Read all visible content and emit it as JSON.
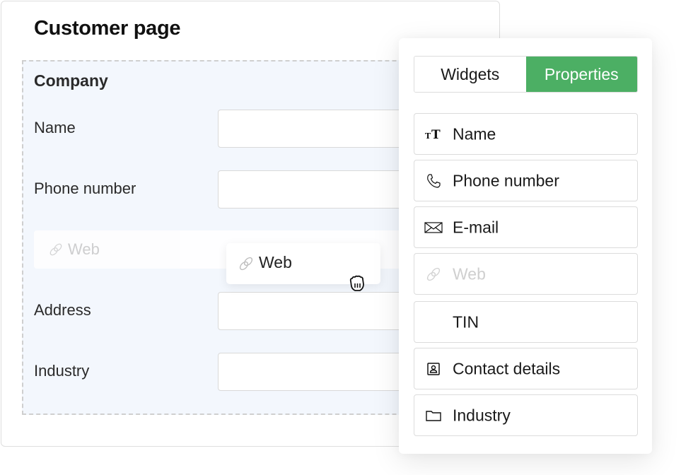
{
  "page": {
    "title": "Customer page"
  },
  "form": {
    "section_title": "Company",
    "fields": [
      {
        "label": "Name",
        "value": ""
      },
      {
        "label": "Phone number",
        "value": ""
      },
      {
        "label": "Address",
        "value": ""
      },
      {
        "label": "Industry",
        "value": ""
      }
    ],
    "drop_placeholder": {
      "label": "Web",
      "icon": "link-icon"
    },
    "dragged_item": {
      "label": "Web",
      "icon": "link-icon"
    },
    "cursor": "grab-hand-cursor"
  },
  "panel": {
    "tabs": [
      {
        "label": "Widgets",
        "active": false
      },
      {
        "label": "Properties",
        "active": true
      }
    ],
    "accent_color": "#4caf64",
    "items": [
      {
        "label": "Name",
        "icon": "text-size-icon",
        "disabled": false
      },
      {
        "label": "Phone number",
        "icon": "phone-icon",
        "disabled": false
      },
      {
        "label": "E-mail",
        "icon": "envelope-icon",
        "disabled": false
      },
      {
        "label": "Web",
        "icon": "link-icon",
        "disabled": true
      },
      {
        "label": "TIN",
        "icon": "",
        "disabled": false
      },
      {
        "label": "Contact details",
        "icon": "contact-card-icon",
        "disabled": false
      },
      {
        "label": "Industry",
        "icon": "folder-icon",
        "disabled": false
      }
    ]
  }
}
